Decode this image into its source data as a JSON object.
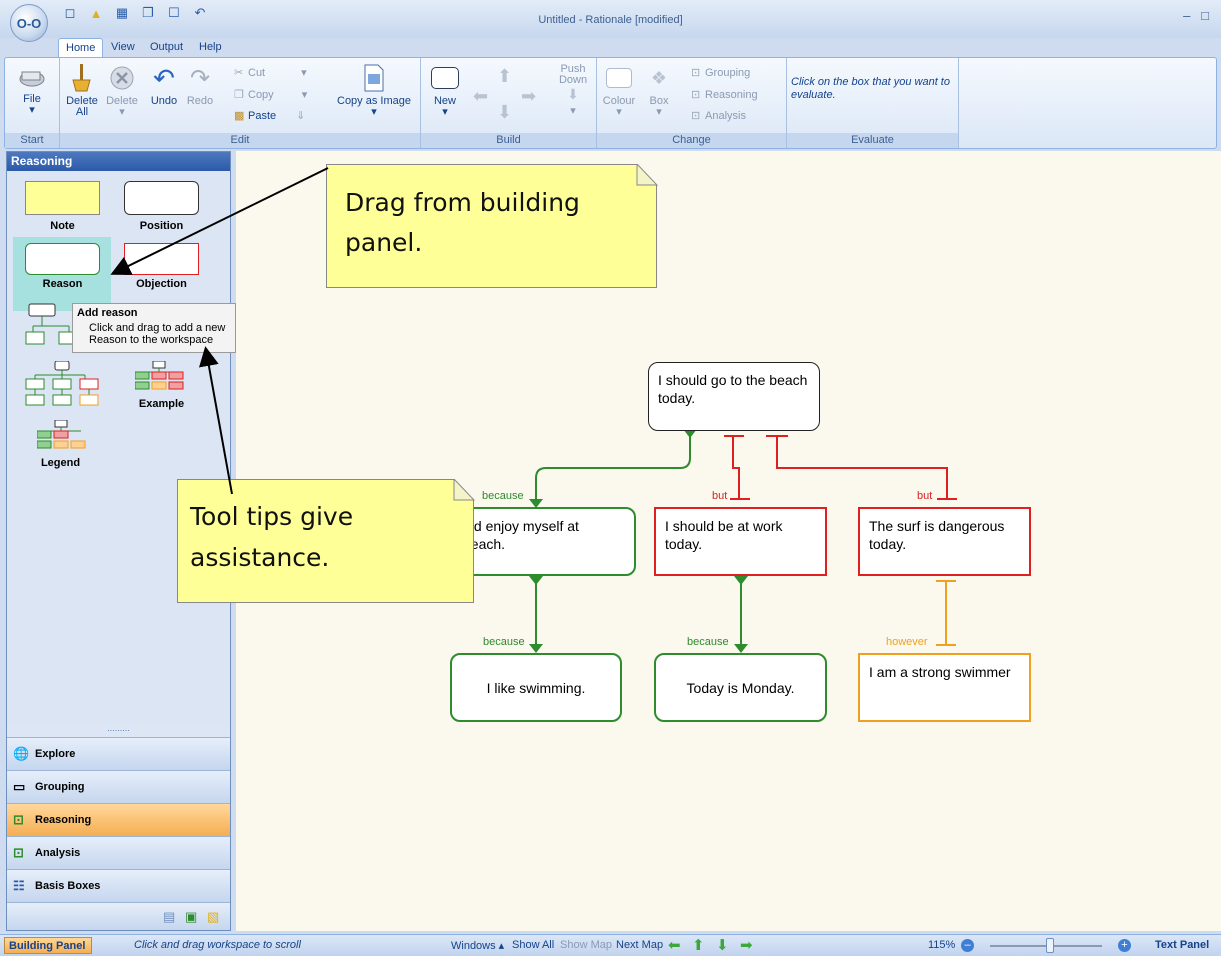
{
  "window": {
    "title": "Untitled - Rationale [modified]",
    "app_logo": "O-O"
  },
  "quick_access": [
    "new-icon",
    "open-icon",
    "save-icon",
    "copy-icon",
    "box-icon",
    "undo-icon"
  ],
  "tabs": [
    "Home",
    "View",
    "Output",
    "Help"
  ],
  "ribbon": {
    "groups": {
      "start": "Start",
      "edit": "Edit",
      "build": "Build",
      "change": "Change",
      "evaluate": "Evaluate"
    },
    "file": "File",
    "delete_all": "Delete All",
    "delete": "Delete",
    "undo": "Undo",
    "redo": "Redo",
    "cut": "Cut",
    "copy": "Copy",
    "paste": "Paste",
    "copy_as_image": "Copy as Image",
    "new": "New",
    "push_down": "Push Down",
    "colour": "Colour",
    "box": "Box",
    "grouping": "Grouping",
    "reasoning": "Reasoning",
    "analysis": "Analysis",
    "evaluate_hint": "Click on the box that you want to evaluate."
  },
  "panel": {
    "title": "Reasoning",
    "templates": {
      "note": "Note",
      "position": "Position",
      "reason": "Reason",
      "objection": "Objection",
      "example": "Example",
      "legend": "Legend"
    },
    "tooltip": {
      "title": "Add reason",
      "body": "Click and drag to add a new Reason to the workspace"
    },
    "nav": [
      "Explore",
      "Grouping",
      "Reasoning",
      "Analysis",
      "Basis Boxes"
    ],
    "grip": "........."
  },
  "canvas": {
    "note1": "Drag from building panel.",
    "note2": "Tool tips give assistance.",
    "position": "I should go to the beach today.",
    "reason1": "uld enjoy myself at beach.",
    "objection1": "I should be at work today.",
    "objection2": "The surf is dangerous today.",
    "reason2": "I like swimming.",
    "reason3": "Today is Monday.",
    "rebuttal": "I am a strong swimmer",
    "labels": {
      "because": "because",
      "but": "but",
      "however": "however"
    }
  },
  "status": {
    "building_panel": "Building Panel",
    "hint": "Click and drag workspace to scroll",
    "windows": "Windows",
    "show_all": "Show All",
    "show_map": "Show Map",
    "next_map": "Next Map",
    "zoom": "115%",
    "text_panel": "Text Panel"
  },
  "colors": {
    "reason": "#2e8b2e",
    "objection": "#e02020",
    "rebuttal": "#f0a020",
    "note": "#ffff98"
  }
}
